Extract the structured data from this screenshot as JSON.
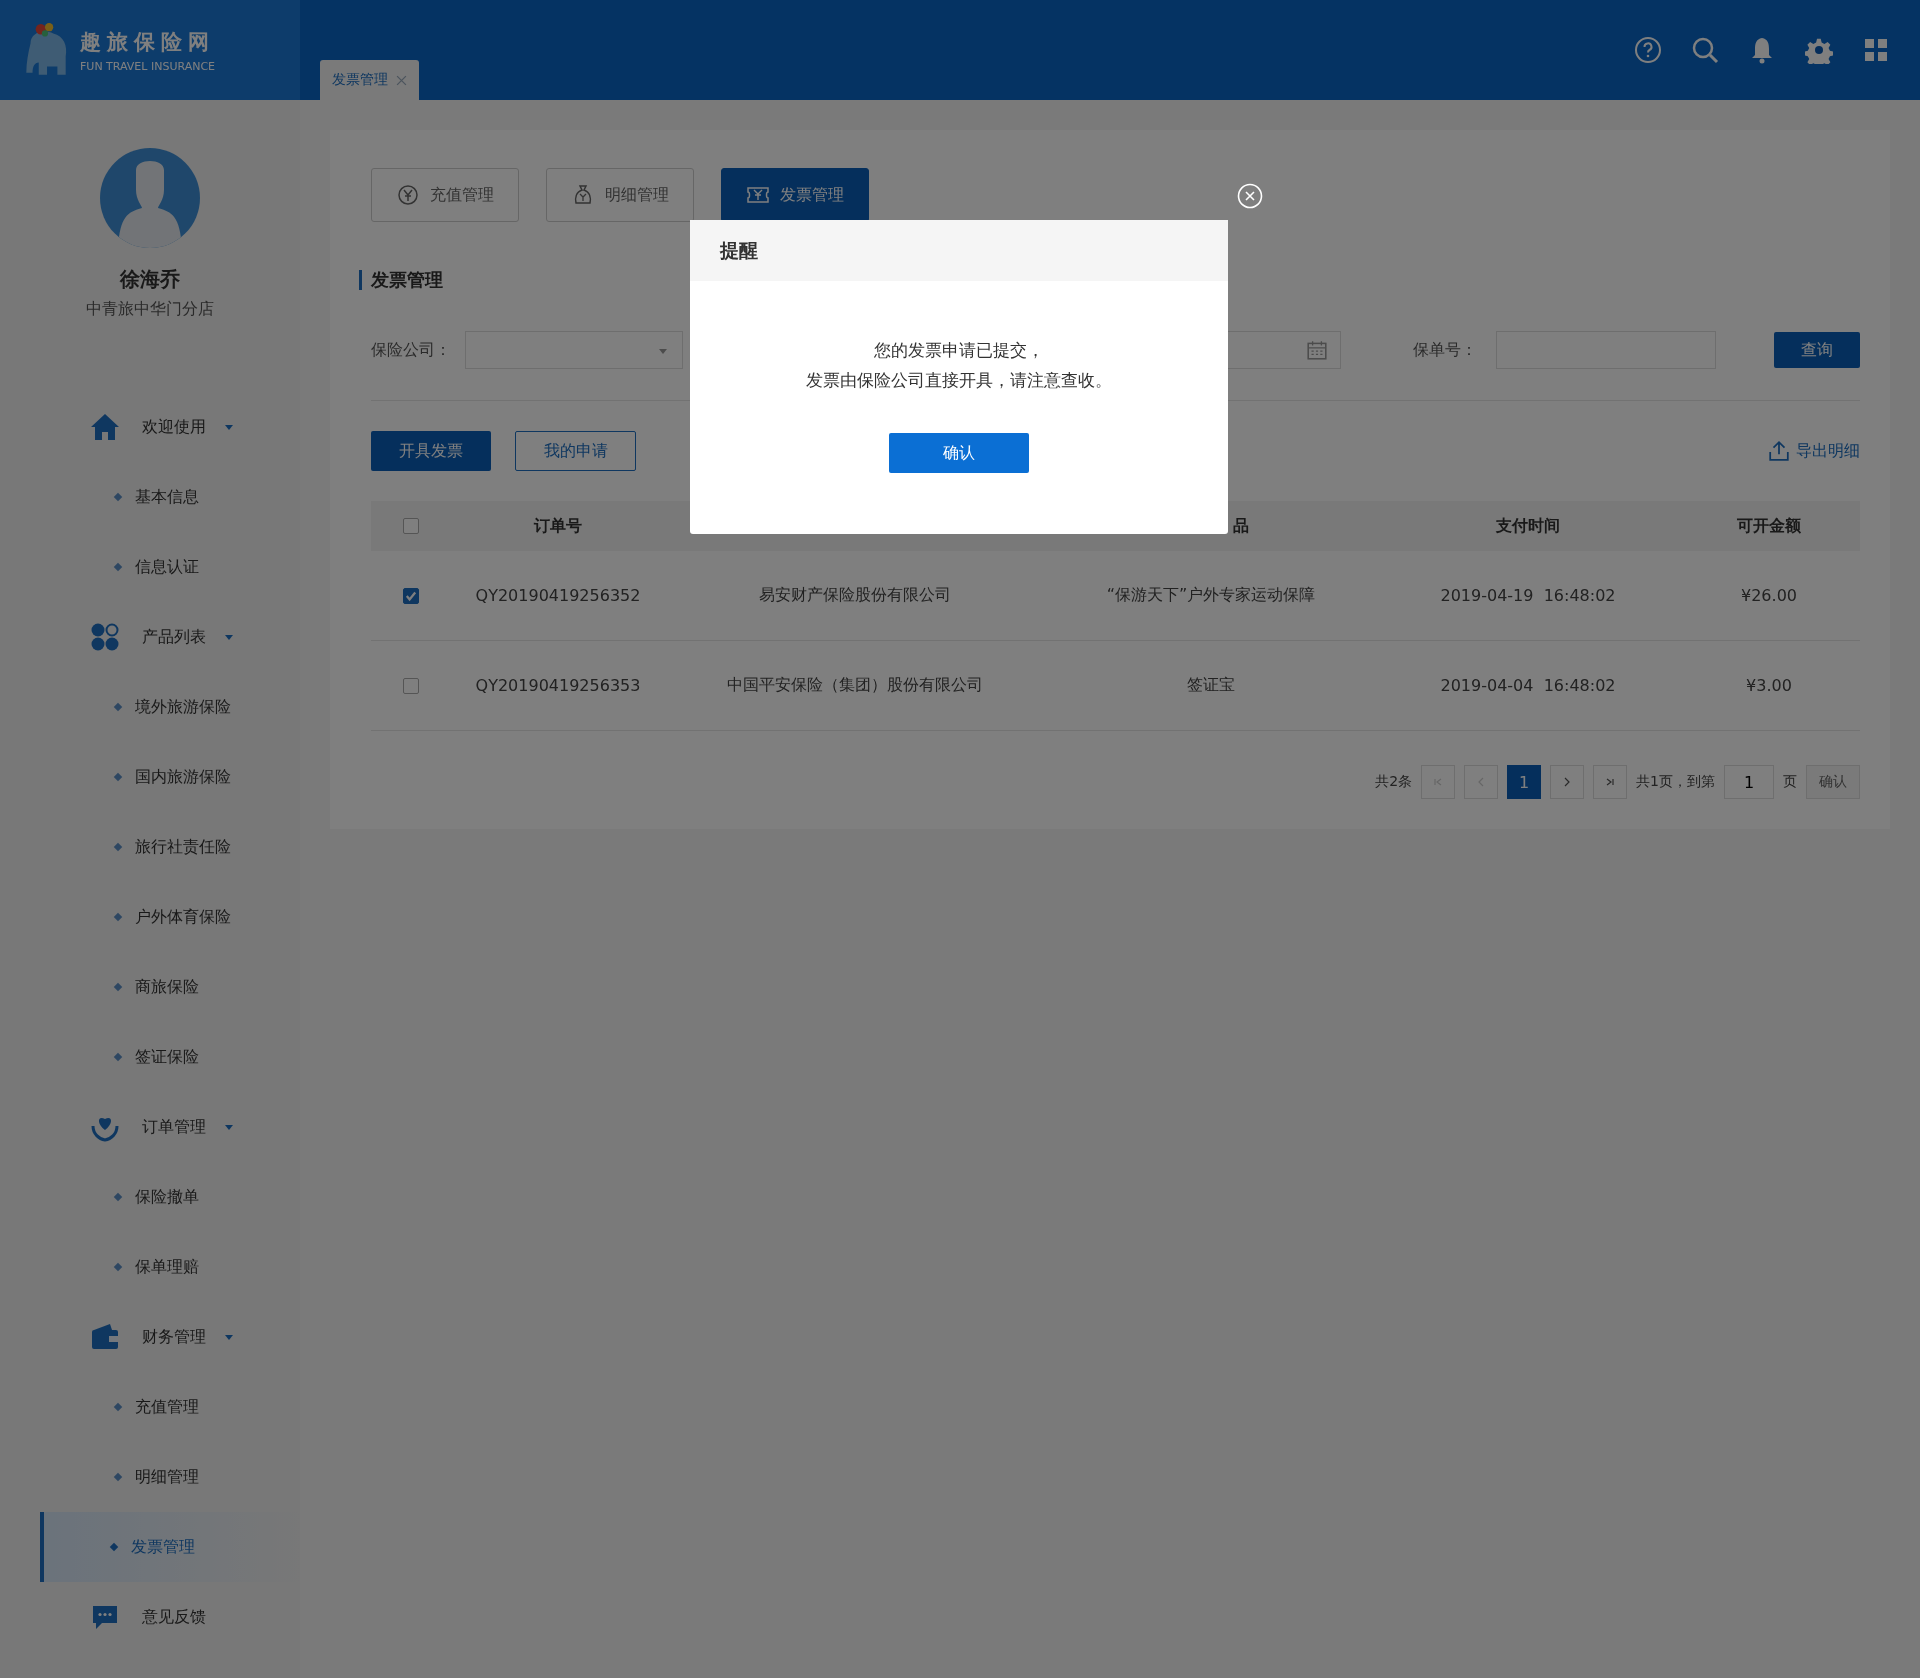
{
  "header": {
    "logo_title": "趣旅保险网",
    "logo_subtitle": "FUN TRAVEL INSURANCE",
    "tabs": [
      {
        "label": "发票管理"
      }
    ]
  },
  "user": {
    "name": "徐海乔",
    "branch": "中青旅中华门分店"
  },
  "sidebar": {
    "items": [
      {
        "label": "欢迎使用",
        "kind": "home",
        "expanded": true,
        "children": [
          {
            "label": "基本信息",
            "selected": false
          },
          {
            "label": "信息认证",
            "selected": false
          }
        ]
      },
      {
        "label": "产品列表",
        "kind": "products",
        "expanded": true,
        "children": [
          {
            "label": "境外旅游保险",
            "selected": false
          },
          {
            "label": "国内旅游保险",
            "selected": false
          },
          {
            "label": "旅行社责任险",
            "selected": false
          },
          {
            "label": "户外体育保险",
            "selected": false
          },
          {
            "label": "商旅保险",
            "selected": false
          },
          {
            "label": "签证保险",
            "selected": false
          }
        ]
      },
      {
        "label": "订单管理",
        "kind": "orders",
        "expanded": true,
        "children": [
          {
            "label": "保险撤单",
            "selected": false
          },
          {
            "label": "保单理赔",
            "selected": false
          }
        ]
      },
      {
        "label": "财务管理",
        "kind": "finance",
        "expanded": true,
        "children": [
          {
            "label": "充值管理",
            "selected": false
          },
          {
            "label": "明细管理",
            "selected": false
          },
          {
            "label": "发票管理",
            "selected": true
          }
        ]
      },
      {
        "label": "意见反馈",
        "kind": "feedback"
      }
    ]
  },
  "page_tabs": [
    {
      "label": "充值管理",
      "kind": "recharge",
      "selected": false
    },
    {
      "label": "明细管理",
      "kind": "details",
      "selected": false
    },
    {
      "label": "发票管理",
      "kind": "invoice",
      "selected": true
    }
  ],
  "section_title": "发票管理",
  "filters": {
    "company_label": "保险公司：",
    "policy_label": "保单号：",
    "query_button": "查询"
  },
  "actions": {
    "issue_button": "开具发票",
    "applications_button": "我的申请",
    "export_link": "导出明细"
  },
  "table": {
    "select_all": {
      "checked": false
    },
    "column_headers": {
      "order_no": "订单号",
      "column_3": "品",
      "pay_time": "支付时间",
      "amount": "可开金额"
    },
    "rows": [
      {
        "checked": true,
        "order_no": "QY20190419256352",
        "company": "易安财产保险股份有限公司",
        "product": "“保游天下”户外专家运动保障",
        "pay_time": "2019-04-19  16:48:02",
        "amount": "¥26.00"
      },
      {
        "checked": false,
        "order_no": "QY20190419256353",
        "company": "中国平安保险（集团）股份有限公司",
        "product": "签证宝",
        "pay_time": "2019-04-04  16:48:02",
        "amount": "¥3.00"
      }
    ]
  },
  "pagination": {
    "total": "共2条",
    "pages": [
      {
        "label": "1",
        "selected": true
      }
    ],
    "page_count": "共1页，到第",
    "jump_value": "1",
    "page_unit": "页",
    "confirm": "确认"
  },
  "modal": {
    "title": "提醒",
    "lines": [
      "您的发票申请已提交，",
      "发票由保险公司直接开具，请注意查收。"
    ],
    "confirm_button": "确认"
  }
}
